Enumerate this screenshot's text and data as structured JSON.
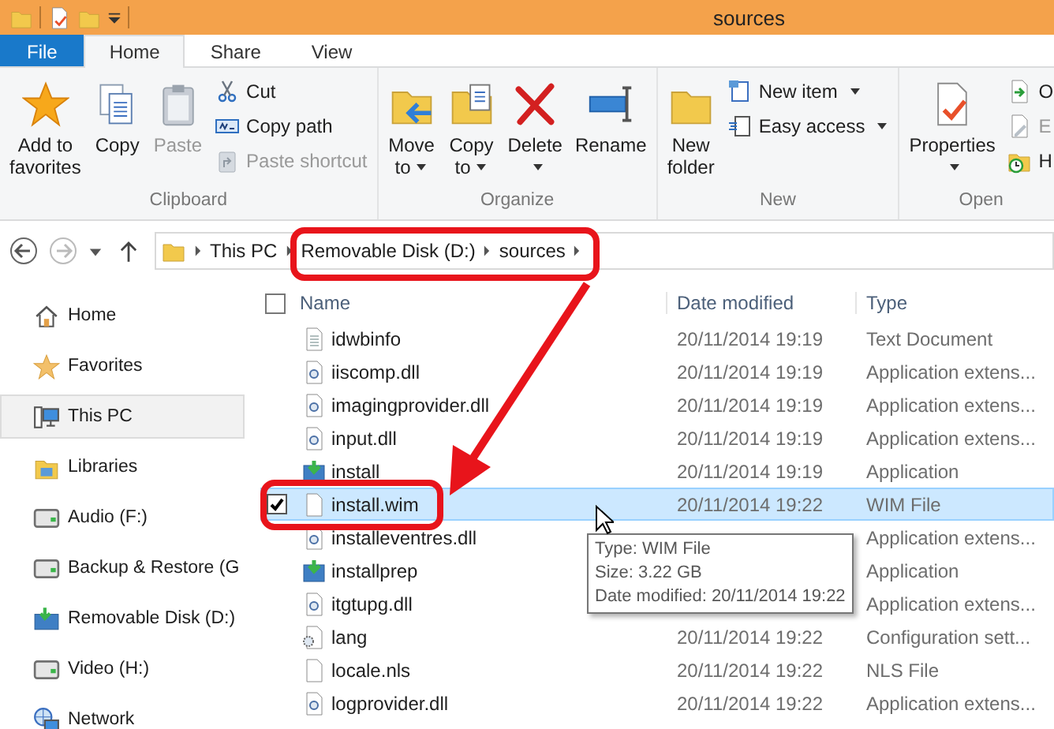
{
  "window": {
    "title": "sources"
  },
  "ribbon_tabs": [
    {
      "label": "File",
      "kind": "file",
      "selected": false
    },
    {
      "label": "Home",
      "kind": "tab",
      "selected": true
    },
    {
      "label": "Share",
      "kind": "tab",
      "selected": false
    },
    {
      "label": "View",
      "kind": "tab",
      "selected": false
    }
  ],
  "ribbon_groups": [
    {
      "label": "Clipboard",
      "items": [
        {
          "label": "Add to favorites",
          "kind": "large",
          "disabled": false,
          "dropdown": false
        },
        {
          "label": "Copy",
          "kind": "large",
          "disabled": false,
          "dropdown": false
        },
        {
          "label": "Paste",
          "kind": "large",
          "disabled": true,
          "dropdown": false
        },
        {
          "label": "Cut",
          "kind": "small",
          "disabled": false,
          "dropdown": false
        },
        {
          "label": "Copy path",
          "kind": "small",
          "disabled": false,
          "dropdown": false
        },
        {
          "label": "Paste shortcut",
          "kind": "small",
          "disabled": true,
          "dropdown": false
        }
      ]
    },
    {
      "label": "Organize",
      "items": [
        {
          "label": "Move to",
          "kind": "large",
          "disabled": false,
          "dropdown": true
        },
        {
          "label": "Copy to",
          "kind": "large",
          "disabled": false,
          "dropdown": true
        },
        {
          "label": "Delete",
          "kind": "large",
          "disabled": false,
          "dropdown": true
        },
        {
          "label": "Rename",
          "kind": "large",
          "disabled": false,
          "dropdown": false
        }
      ]
    },
    {
      "label": "New",
      "items": [
        {
          "label": "New folder",
          "kind": "large",
          "disabled": false,
          "dropdown": false
        },
        {
          "label": "New item",
          "kind": "small",
          "disabled": false,
          "dropdown": true
        },
        {
          "label": "Easy access",
          "kind": "small",
          "disabled": false,
          "dropdown": true
        }
      ]
    },
    {
      "label": "Open",
      "items": [
        {
          "label": "Properties",
          "kind": "large",
          "disabled": false,
          "dropdown": true
        },
        {
          "label": "O",
          "kind": "small",
          "disabled": false,
          "dropdown": false
        },
        {
          "label": "E",
          "kind": "small",
          "disabled": true,
          "dropdown": false
        },
        {
          "label": "H",
          "kind": "small",
          "disabled": false,
          "dropdown": false
        }
      ]
    }
  ],
  "address": {
    "crumbs": [
      "This PC",
      "Removable Disk (D:)",
      "sources"
    ]
  },
  "nav_items": [
    {
      "label": "Home",
      "selected": false
    },
    {
      "label": "Favorites",
      "selected": false
    },
    {
      "label": "This PC",
      "selected": true
    },
    {
      "label": "Libraries",
      "selected": false
    },
    {
      "label": "Audio (F:)",
      "selected": false
    },
    {
      "label": "Backup & Restore (G",
      "selected": false
    },
    {
      "label": "Removable Disk (D:)",
      "selected": false
    },
    {
      "label": "Video (H:)",
      "selected": false
    },
    {
      "label": "Network",
      "selected": false
    }
  ],
  "header_checkbox": {
    "checked": false
  },
  "columns": [
    "Name",
    "Date modified",
    "Type"
  ],
  "rows": [
    {
      "name": "idwbinfo",
      "kind": "text",
      "date": "20/11/2014 19:19",
      "type": "Text Document",
      "selected": false
    },
    {
      "name": "iiscomp.dll",
      "kind": "dll",
      "date": "20/11/2014 19:19",
      "type": "Application extens...",
      "selected": false
    },
    {
      "name": "imagingprovider.dll",
      "kind": "dll",
      "date": "20/11/2014 19:19",
      "type": "Application extens...",
      "selected": false
    },
    {
      "name": "input.dll",
      "kind": "dll",
      "date": "20/11/2014 19:19",
      "type": "Application extens...",
      "selected": false
    },
    {
      "name": "install",
      "kind": "app",
      "date": "20/11/2014 19:19",
      "type": "Application",
      "selected": false
    },
    {
      "name": "install.wim",
      "kind": "blank",
      "date": "20/11/2014 19:22",
      "type": "WIM File",
      "selected": true
    },
    {
      "name": "installeventres.dll",
      "kind": "dll",
      "type": "Application extens...",
      "selected": false
    },
    {
      "name": "installprep",
      "kind": "app",
      "type": "Application",
      "selected": false
    },
    {
      "name": "itgtupg.dll",
      "kind": "dll",
      "type": "Application extens...",
      "selected": false
    },
    {
      "name": "lang",
      "kind": "config",
      "date": "20/11/2014 19:22",
      "type": "Configuration sett...",
      "selected": false
    },
    {
      "name": "locale.nls",
      "kind": "blank",
      "date": "20/11/2014 19:22",
      "type": "NLS File",
      "selected": false
    },
    {
      "name": "logprovider.dll",
      "kind": "dll",
      "date": "20/11/2014 19:22",
      "type": "Application extens...",
      "selected": false
    }
  ],
  "tooltip": {
    "lines": [
      "Type: WIM File",
      "Size: 3.22 GB",
      "Date modified: 20/11/2014 19:22"
    ]
  }
}
